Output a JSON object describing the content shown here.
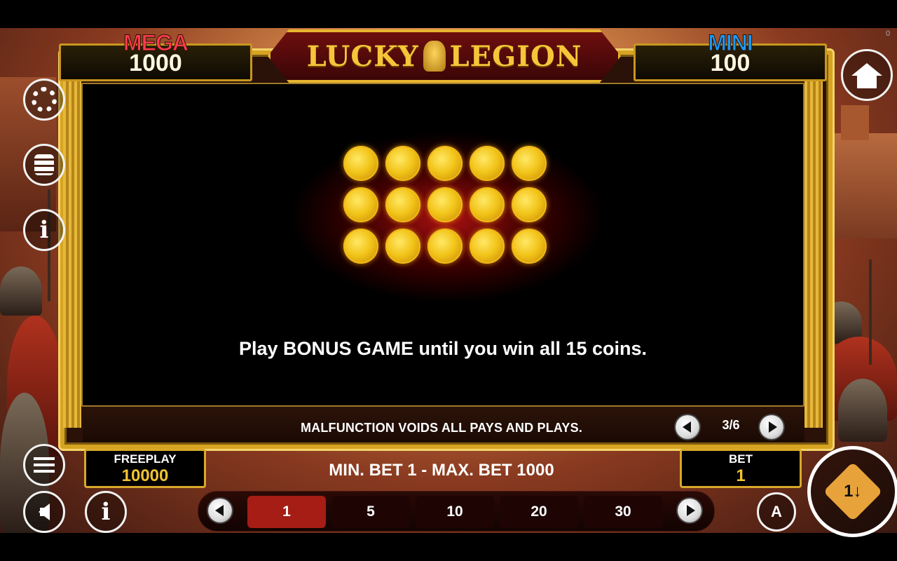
{
  "jackpots": {
    "mega": {
      "label": "MEGA",
      "value": "1000",
      "color": "#ff3b4e"
    },
    "mini": {
      "label": "MINI",
      "value": "100",
      "color": "#1a9bff"
    }
  },
  "logo": {
    "left": "LUCKY",
    "right": "LEGION"
  },
  "help": {
    "text": "Play BONUS GAME until you win all 15 coins.",
    "coin_count": 15,
    "page": "3/6"
  },
  "disclaimer": "MALFUNCTION VOIDS ALL PAYS AND PLAYS.",
  "freeplay": {
    "label": "FREEPLAY",
    "value": "10000"
  },
  "bet": {
    "label": "BET",
    "value": "1"
  },
  "bet_limits": "MIN. BET 1 - MAX. BET 1000",
  "bet_options": [
    "1",
    "5",
    "10",
    "20",
    "30"
  ],
  "selected_bet": "1",
  "auto_label": "A",
  "spin_label": "1↓",
  "corner_mark": "0",
  "icons": [
    "gear-icon",
    "coin-stack-icon",
    "info-icon",
    "menu-icon",
    "sound-icon",
    "home-icon",
    "chevron-left-icon",
    "chevron-right-icon",
    "autoplay-icon",
    "spin-icon"
  ],
  "accent": "#d9a82a"
}
